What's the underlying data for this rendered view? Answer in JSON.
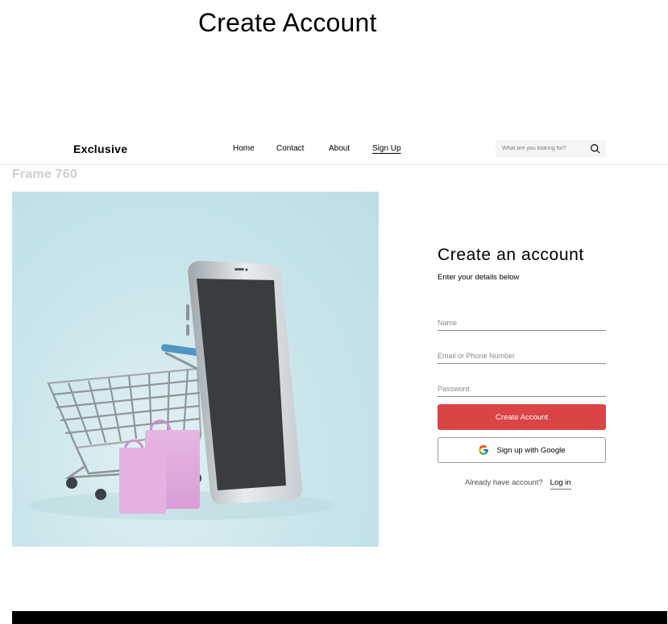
{
  "frame": {
    "title": "Create Account",
    "label": "Frame 760"
  },
  "header": {
    "logo": "Exclusive",
    "nav": [
      {
        "label": "Home"
      },
      {
        "label": "Contact"
      },
      {
        "label": "About"
      },
      {
        "label": "Sign Up",
        "active": true
      }
    ],
    "search": {
      "placeholder": "What are you looking for?",
      "icon": "search-icon"
    }
  },
  "hero": {
    "image": "shopping-cart-phone-illustration"
  },
  "form": {
    "title": "Create an account",
    "subtitle": "Enter your details below",
    "fields": [
      {
        "placeholder": "Name",
        "value": ""
      },
      {
        "placeholder": "Email or Phone Number",
        "value": ""
      },
      {
        "placeholder": "Password",
        "value": ""
      }
    ],
    "submit_label": "Create Account",
    "google_label": "Sign up with Google",
    "login_prompt": "Already have account?",
    "login_link": "Log in"
  },
  "colors": {
    "accent": "#db4444",
    "hero_bg": "#cbe6ec",
    "footer": "#000000"
  }
}
